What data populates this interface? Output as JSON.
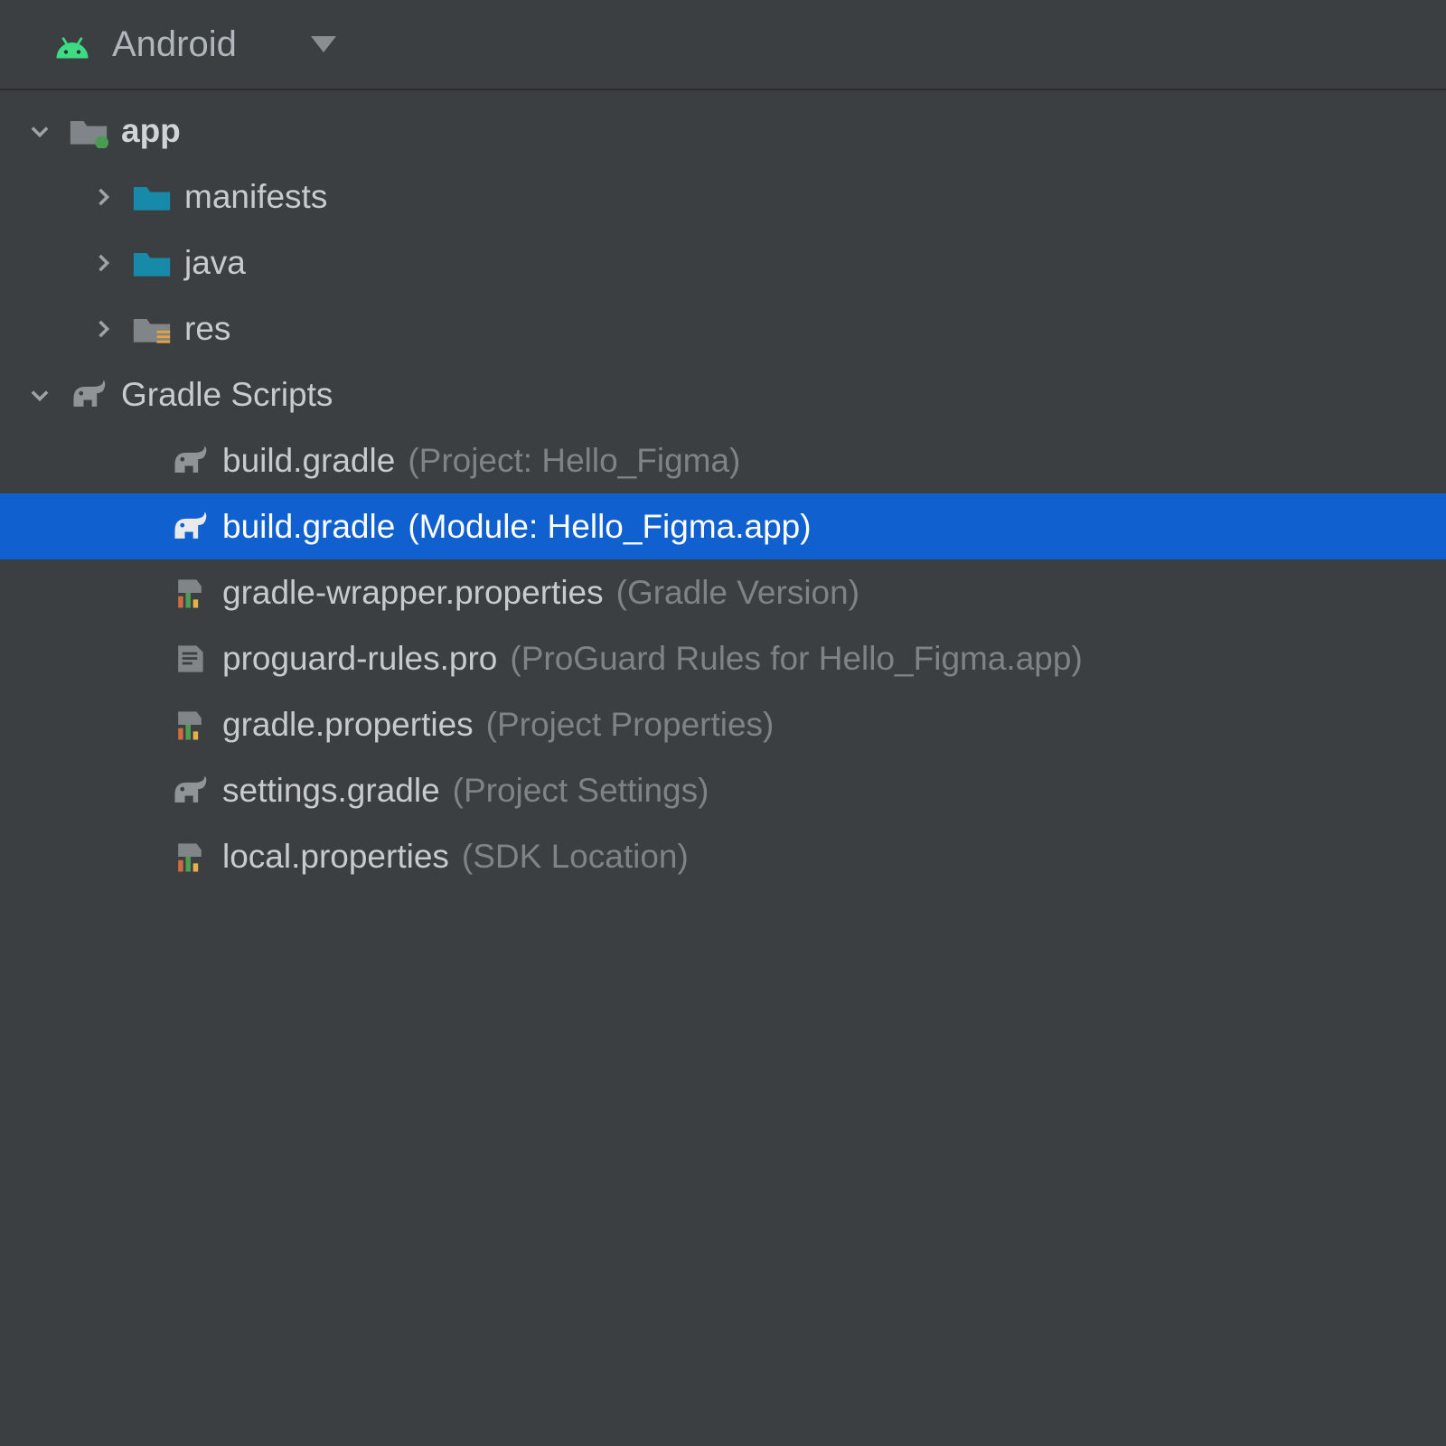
{
  "topbar": {
    "label": "Android"
  },
  "tree": {
    "app": {
      "label": "app",
      "children": {
        "manifests": "manifests",
        "java": "java",
        "res": "res"
      }
    },
    "gradle": {
      "label": "Gradle Scripts",
      "build_project": {
        "name": "build.gradle",
        "note": "(Project: Hello_Figma)"
      },
      "build_module": {
        "name": "build.gradle",
        "note": "(Module: Hello_Figma.app)"
      },
      "wrapper": {
        "name": "gradle-wrapper.properties",
        "note": "(Gradle Version)"
      },
      "proguard": {
        "name": "proguard-rules.pro",
        "note": "(ProGuard Rules for Hello_Figma.app)"
      },
      "gradle_props": {
        "name": "gradle.properties",
        "note": "(Project Properties)"
      },
      "settings": {
        "name": "settings.gradle",
        "note": "(Project Settings)"
      },
      "local": {
        "name": "local.properties",
        "note": "(SDK Location)"
      }
    }
  },
  "colors": {
    "selection": "#1060d0",
    "background": "#3c3f41",
    "folder_teal": "#168aa8",
    "folder_gray": "#7f8588",
    "accent_green": "#3ddc84"
  }
}
